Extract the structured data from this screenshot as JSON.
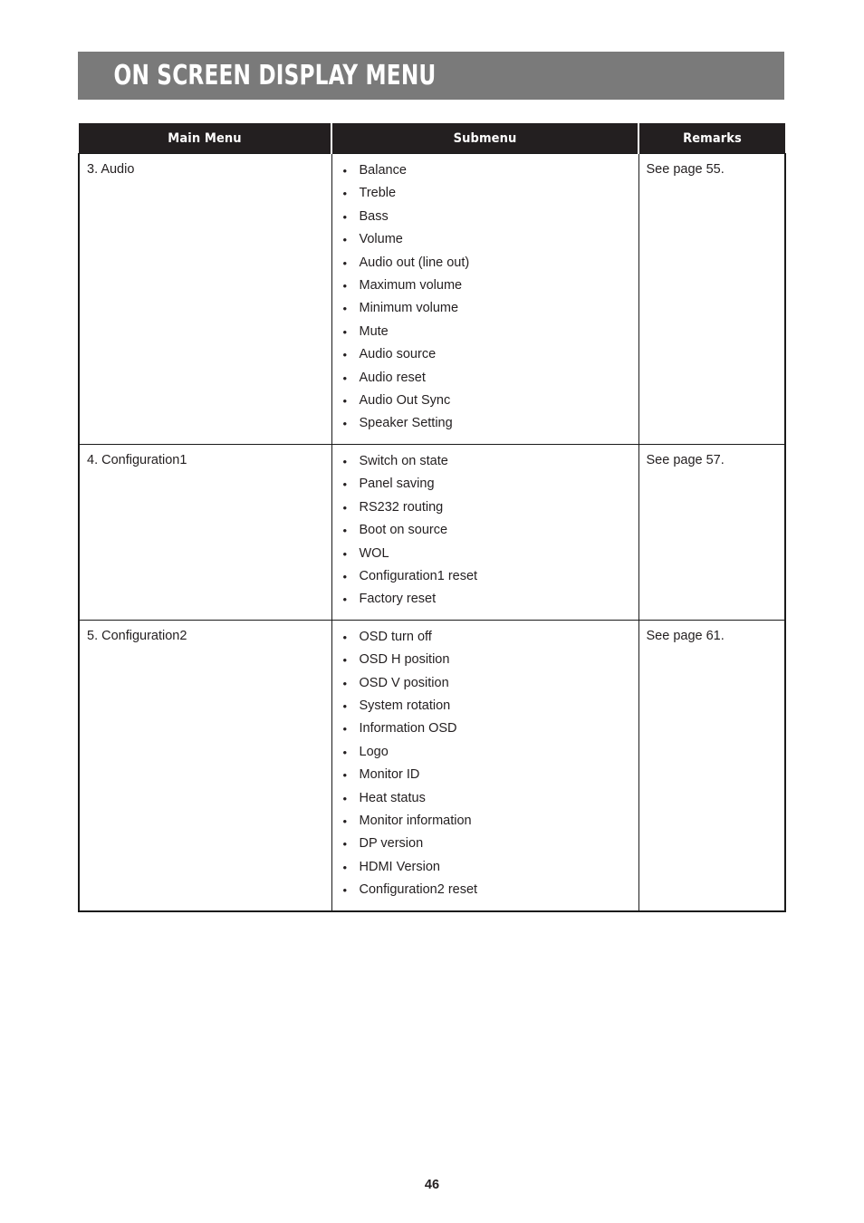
{
  "banner": {
    "title": "ON SCREEN DISPLAY MENU",
    "bg_color": "#7a7a7a",
    "text_color": "#ffffff"
  },
  "table": {
    "header_bg": "#231f20",
    "columns": [
      {
        "label": "Main Menu"
      },
      {
        "label": "Submenu"
      },
      {
        "label": "Remarks"
      }
    ],
    "bullet": "•",
    "rows": [
      {
        "main": "3. Audio",
        "submenu": [
          "Balance",
          "Treble",
          "Bass",
          "Volume",
          "Audio out (line out)",
          "Maximum volume",
          "Minimum volume",
          "Mute",
          "Audio source",
          "Audio reset",
          "Audio Out Sync",
          "Speaker Setting"
        ],
        "remarks": "See page 55."
      },
      {
        "main": "4. Configuration1",
        "submenu": [
          "Switch on state",
          "Panel saving",
          "RS232 routing",
          "Boot on source",
          "WOL",
          "Configuration1 reset",
          "Factory reset"
        ],
        "remarks": "See page 57."
      },
      {
        "main": "5. Configuration2",
        "submenu": [
          "OSD turn off",
          "OSD H position",
          "OSD V position",
          "System rotation",
          "Information OSD",
          "Logo",
          "Monitor ID",
          "Heat status",
          "Monitor information",
          "DP version",
          "HDMI Version",
          "Configuration2 reset"
        ],
        "remarks": "See page 61."
      }
    ]
  },
  "footer": {
    "page_number": "46"
  }
}
